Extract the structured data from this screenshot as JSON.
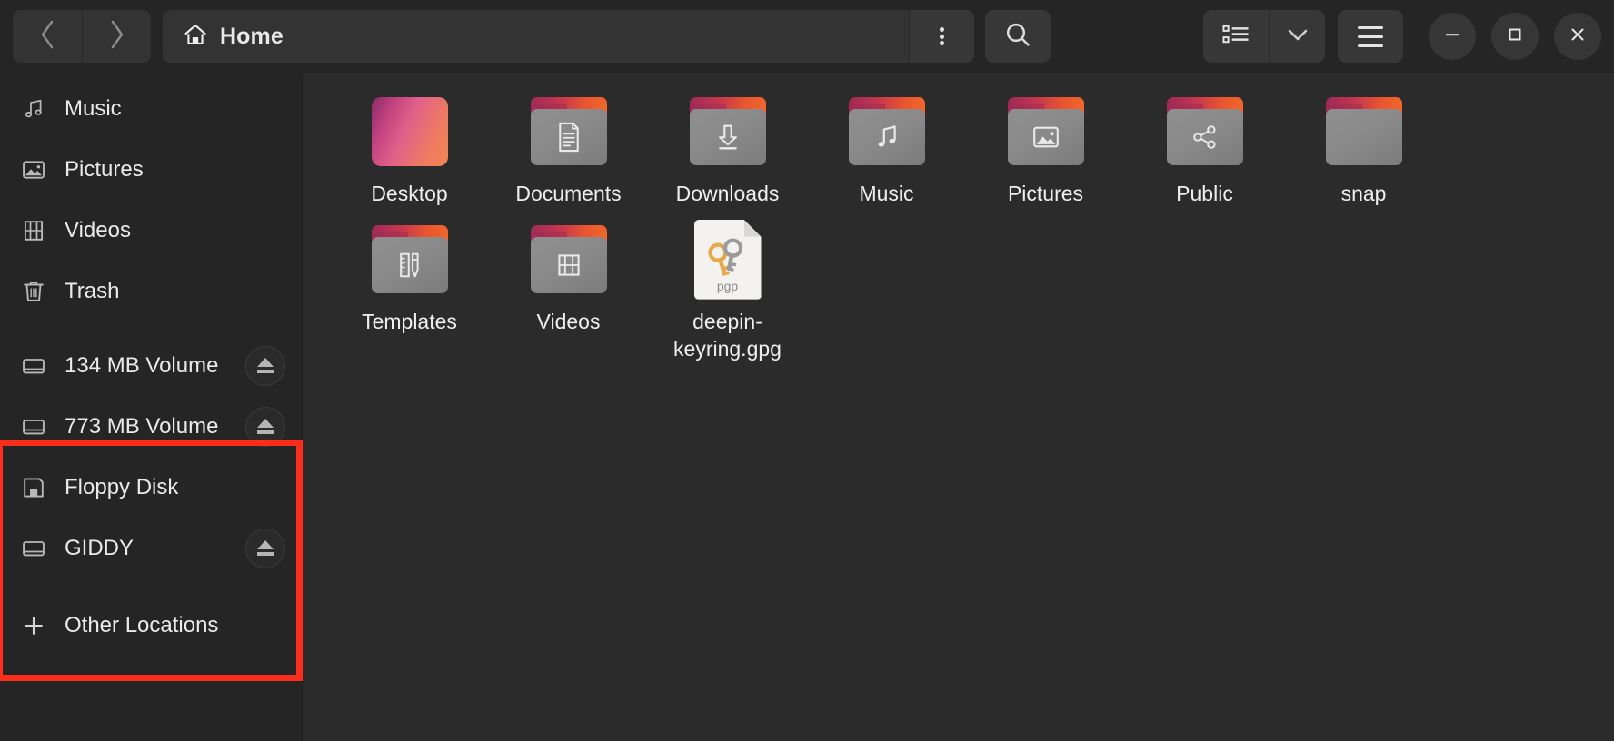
{
  "window": {
    "title": "Home",
    "nav": {
      "back_label": "Back",
      "forward_label": "Forward"
    },
    "pathbar": {
      "crumb_label": "Home",
      "crumb_icon": "home-icon"
    },
    "toolbar": {
      "kebab_label": "Path options",
      "search_label": "Search",
      "view_list_label": "List view",
      "view_chevron_label": "View options",
      "hamburger_label": "Main menu"
    },
    "controls": {
      "minimize_label": "—",
      "maximize_label": "□",
      "close_label": "✕"
    }
  },
  "sidebar": {
    "items": [
      {
        "label": "Music",
        "icon": "music-note-icon",
        "eject": false
      },
      {
        "label": "Pictures",
        "icon": "image-icon",
        "eject": false
      },
      {
        "label": "Videos",
        "icon": "film-icon",
        "eject": false
      },
      {
        "label": "Trash",
        "icon": "trash-icon",
        "eject": false
      }
    ],
    "volumes": [
      {
        "label": "134 MB Volume",
        "icon": "drive-icon",
        "eject": true
      },
      {
        "label": "773 MB Volume",
        "icon": "drive-icon",
        "eject": true
      },
      {
        "label": "Floppy Disk",
        "icon": "floppy-icon",
        "eject": false
      },
      {
        "label": "GIDDY",
        "icon": "drive-icon",
        "eject": true
      }
    ],
    "other_locations": {
      "label": "Other Locations",
      "icon": "plus-icon"
    },
    "highlight_color": "#fc2d1b"
  },
  "content": {
    "files": [
      {
        "name": "Desktop",
        "type": "desktop-tile",
        "emblem": "none"
      },
      {
        "name": "Documents",
        "type": "folder",
        "emblem": "document-icon"
      },
      {
        "name": "Downloads",
        "type": "folder",
        "emblem": "download-arrow-icon"
      },
      {
        "name": "Music",
        "type": "folder",
        "emblem": "music-note-icon"
      },
      {
        "name": "Pictures",
        "type": "folder",
        "emblem": "image-icon"
      },
      {
        "name": "Public",
        "type": "folder",
        "emblem": "share-icon"
      },
      {
        "name": "snap",
        "type": "folder",
        "emblem": "none"
      },
      {
        "name": "Templates",
        "type": "folder",
        "emblem": "template-icon"
      },
      {
        "name": "Videos",
        "type": "folder",
        "emblem": "film-icon"
      },
      {
        "name": "deepin-keyring.gpg",
        "type": "gpg-file",
        "emblem": "keys-icon",
        "badge": "pgp"
      }
    ]
  },
  "colors": {
    "window_bg": "#252525",
    "content_bg": "#2b2b2b",
    "button_bg": "#373737",
    "text": "#eaeaea",
    "folder_gray": "#878787",
    "accent_red": "#fc2d1b"
  }
}
